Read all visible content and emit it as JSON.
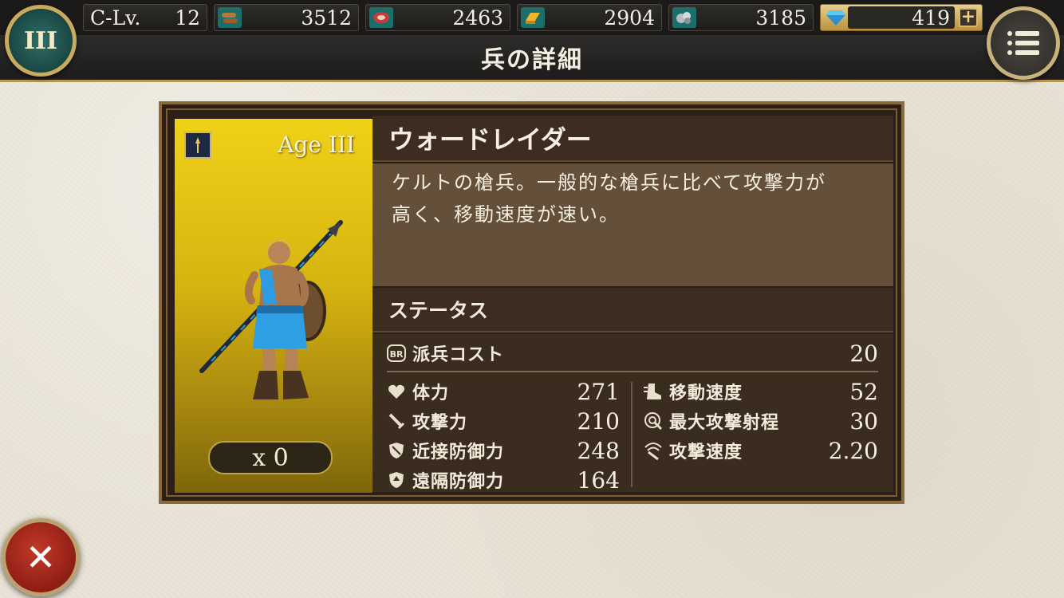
{
  "top_bar": {
    "clv_label": "C-Lv.",
    "clv_value": "12",
    "resources": [
      {
        "icon": "wood-icon",
        "value": "3512"
      },
      {
        "icon": "food-icon",
        "value": "2463"
      },
      {
        "icon": "gold-icon",
        "value": "2904"
      },
      {
        "icon": "iron-icon",
        "value": "3185"
      }
    ],
    "gems": {
      "icon": "gem-icon",
      "value": "419",
      "plus_label": "+"
    },
    "age_emblem": "III"
  },
  "header": {
    "title": "兵の詳細"
  },
  "unit": {
    "age_label": "Age III",
    "count": "x 0",
    "name": "ウォードレイダー",
    "description_line1": "ケルトの槍兵。一般的な槍兵に比べて攻撃力が",
    "description_line2": "高く、移動速度が速い。"
  },
  "status": {
    "heading": "ステータス",
    "cost": {
      "icon": "br-icon",
      "label": "派兵コスト",
      "value": "20"
    },
    "left": [
      {
        "icon": "heart-icon",
        "label": "体力",
        "value": "271"
      },
      {
        "icon": "sword-icon",
        "label": "攻撃力",
        "value": "210"
      },
      {
        "icon": "shield-icon",
        "label": "近接防御力",
        "value": "248"
      },
      {
        "icon": "ranged-shield-icon",
        "label": "遠隔防御力",
        "value": "164"
      }
    ],
    "right": [
      {
        "icon": "boot-icon",
        "label": "移動速度",
        "value": "52"
      },
      {
        "icon": "range-icon",
        "label": "最大攻撃射程",
        "value": "30"
      },
      {
        "icon": "attack-speed-icon",
        "label": "攻撃速度",
        "value": "2.20"
      }
    ]
  },
  "close_label": "✕"
}
